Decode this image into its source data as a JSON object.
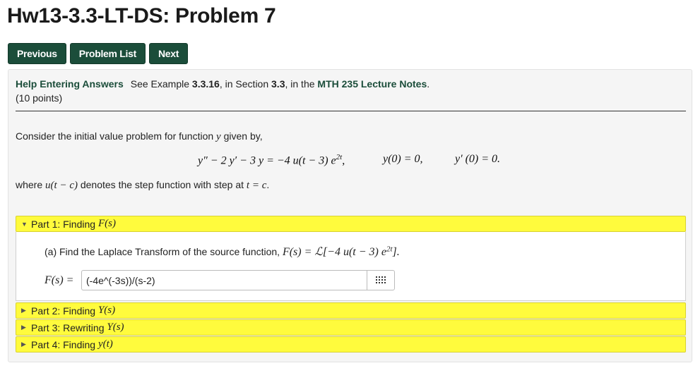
{
  "page": {
    "title": "Hw13-3.3-LT-DS: Problem 7"
  },
  "nav": {
    "previous": "Previous",
    "problem_list": "Problem List",
    "next": "Next"
  },
  "problem": {
    "help_link": "Help Entering Answers",
    "see_prefix": "See Example ",
    "example_ref": "3.3.16",
    "in_section": ", in Section ",
    "section_ref": "3.3",
    "in_the": ", in the ",
    "notes_link": "MTH 235 Lecture Notes",
    "notes_suffix": ".",
    "points": "(10 points)",
    "intro_text": "Consider the initial value problem for function ",
    "intro_var": "y",
    "intro_suffix": " given by,",
    "equation": "y″ − 2 y′ − 3 y = −4 u(t − 3) e",
    "equation_exp": "2t",
    "equation_comma": ",",
    "ic1": "y(0) = 0,",
    "ic2": "y′ (0) = 0.",
    "where_prefix": "where ",
    "where_math": "u(t − c)",
    "where_mid": " denotes the step function with step at ",
    "where_math2": "t = c",
    "where_suffix": "."
  },
  "parts": [
    {
      "label": "Part 1: Finding ",
      "math": "F(s)",
      "expanded": true
    },
    {
      "label": "Part 2: Finding ",
      "math": "Y(s)",
      "expanded": false
    },
    {
      "label": "Part 3: Rewriting ",
      "math": "Y(s)",
      "expanded": false
    },
    {
      "label": "Part 4: Finding ",
      "math": "y(t)",
      "expanded": false
    }
  ],
  "part1": {
    "question_prefix": "(a) Find the Laplace Transform of the source function, ",
    "question_math": "F(s) = ℒ[−4 u(t − 3) e",
    "question_exp": "2t",
    "question_close": "].",
    "answer_label": "F(s) =",
    "answer_value": "(-4e^(-3s))/(s-2)"
  },
  "icons": {
    "expanded_arrow": "▼",
    "collapsed_arrow": "▶",
    "equation_editor": "grid-icon"
  }
}
